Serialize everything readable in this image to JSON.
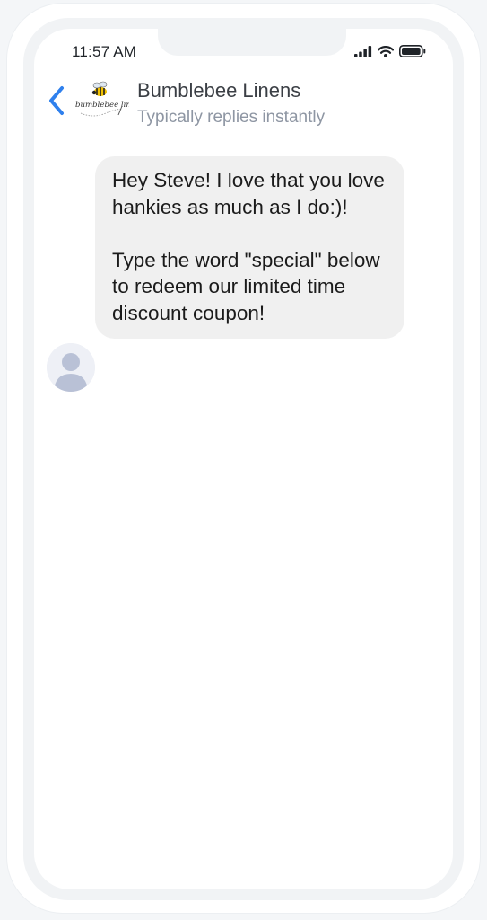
{
  "status_bar": {
    "time": "11:57 AM",
    "icons": [
      "signal-icon",
      "wifi-icon",
      "battery-icon"
    ]
  },
  "header": {
    "back_icon": "chevron-left-icon",
    "logo_text": "bumblebee linens",
    "title": "Bumblebee Linens",
    "subtitle": "Typically replies instantly"
  },
  "messages": [
    {
      "sender": "Bumblebee Linens",
      "text": "Hey Steve! I love that you love hankies as much as I do:)!\n\nType the word \"special\" below to redeem our limited time discount coupon!"
    }
  ],
  "colors": {
    "accent": "#2f80ed",
    "bubble_bg": "#f0f0f0",
    "subtitle": "#8e96a3",
    "title": "#3b3f45"
  }
}
